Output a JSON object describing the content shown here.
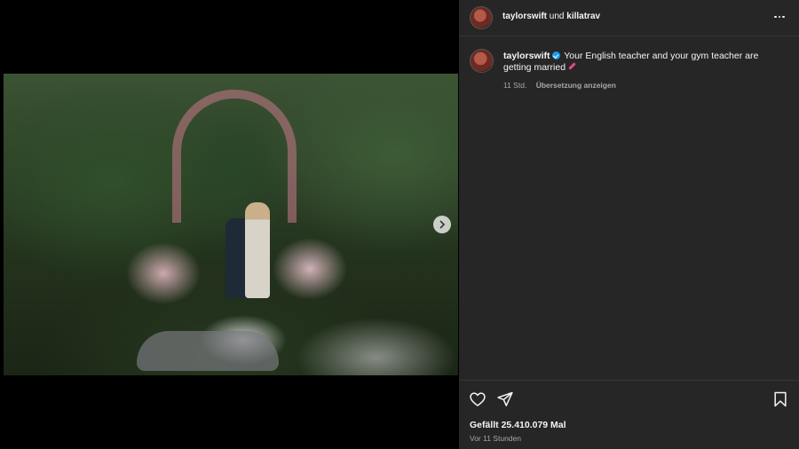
{
  "post": {
    "author": "taylorswift",
    "joiner": "und",
    "coauthor": "killatrav",
    "next_icon": "chevron-right-icon",
    "more_icon": "more-options-icon"
  },
  "caption": {
    "username": "taylorswift",
    "text": "Your English teacher and your gym teacher are getting married",
    "emoji": "pen-icon",
    "age": "11 Std.",
    "translate_label": "Übersetzung anzeigen"
  },
  "actions": {
    "icons": [
      "heart-icon",
      "share-icon",
      "save-icon"
    ]
  },
  "likes_text": "Gefällt 25.410.079 Mal",
  "timestamp_text": "Vor 11 Stunden",
  "colors": {
    "panel_bg": "#262626",
    "verified": "#1d9bf0",
    "muted_text": "#a8a8a8"
  }
}
